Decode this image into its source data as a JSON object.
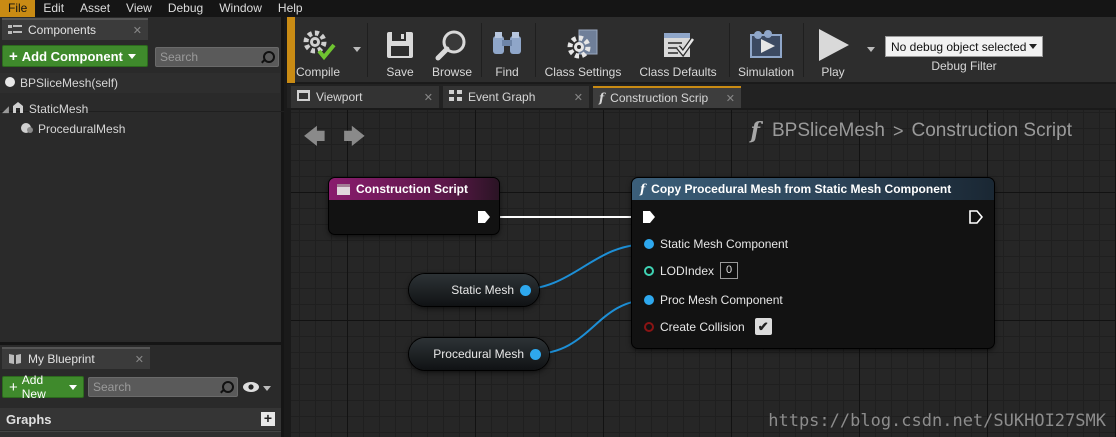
{
  "menu": [
    "File",
    "Edit",
    "Asset",
    "View",
    "Debug",
    "Window",
    "Help"
  ],
  "components_panel": {
    "tab_title": "Components",
    "add_button": "Add Component",
    "search_placeholder": "Search",
    "items": [
      "BPSliceMesh(self)",
      "StaticMesh",
      "ProceduralMesh"
    ]
  },
  "blueprint_panel": {
    "tab_title": "My Blueprint",
    "add_button": "Add New",
    "search_placeholder": "Search",
    "section": "Graphs"
  },
  "toolbar": {
    "compile": "Compile",
    "save": "Save",
    "browse": "Browse",
    "find": "Find",
    "class_settings": "Class Settings",
    "class_defaults": "Class Defaults",
    "simulation": "Simulation",
    "play": "Play",
    "debug_selected": "No debug object selected",
    "debug_filter": "Debug Filter"
  },
  "tabs": [
    "Viewport",
    "Event Graph",
    "Construction Scrip"
  ],
  "breadcrumb": {
    "blueprint": "BPSliceMesh",
    "graph": "Construction Script"
  },
  "nodes": {
    "construction_script": "Construction Script",
    "copy_node_title": "Copy Procedural Mesh from Static Mesh Component",
    "pins": {
      "static_mesh_component": "Static Mesh Component",
      "lod_index": "LODIndex",
      "lod_value": "0",
      "proc_mesh_component": "Proc Mesh Component",
      "create_collision": "Create Collision"
    },
    "var_static_mesh": "Static Mesh",
    "var_procedural_mesh": "Procedural Mesh"
  },
  "watermark": "https://blog.csdn.net/SUKHOI27SMK",
  "colors": {
    "accent_orange": "#c98b14",
    "add_green": "#3f8a2c",
    "event_header": "#8a1c6e",
    "function_header": "#3b5f7a",
    "object_pin": "#2ea8ee",
    "int_pin": "#3fd3b4",
    "bool_pin": "#8a1414"
  }
}
